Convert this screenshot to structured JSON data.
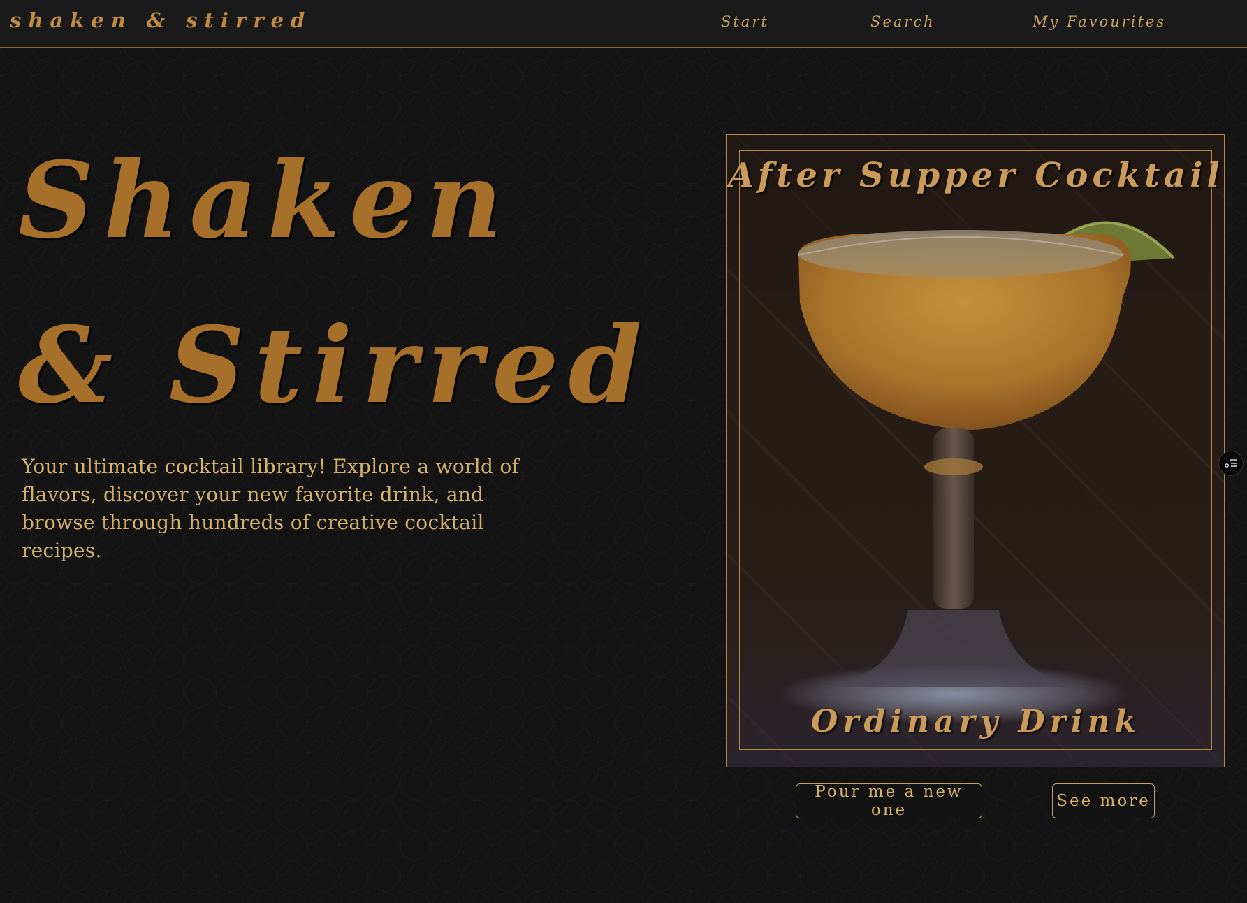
{
  "nav": {
    "brand": "shaken & stirred",
    "links": [
      "Start",
      "Search",
      "My Favourites"
    ]
  },
  "hero": {
    "title_line1": "Shaken",
    "title_line2": "& Stirred",
    "description": "Your ultimate cocktail library! Explore a world of flavors, discover your new favorite drink, and browse through hundreds of creative cocktail recipes."
  },
  "featured": {
    "name": "After Supper Cocktail",
    "category": "Ordinary Drink",
    "image_icon": "coupe-glass-cocktail-photo"
  },
  "buttons": {
    "pour": "Pour me a new one",
    "more": "See more"
  },
  "widget": {
    "icon": "list-settings-icon"
  },
  "colors": {
    "accent": "#c9a15f",
    "title_gold": "#a6702b",
    "background": "#131313",
    "navbar": "#1a1a1a"
  }
}
